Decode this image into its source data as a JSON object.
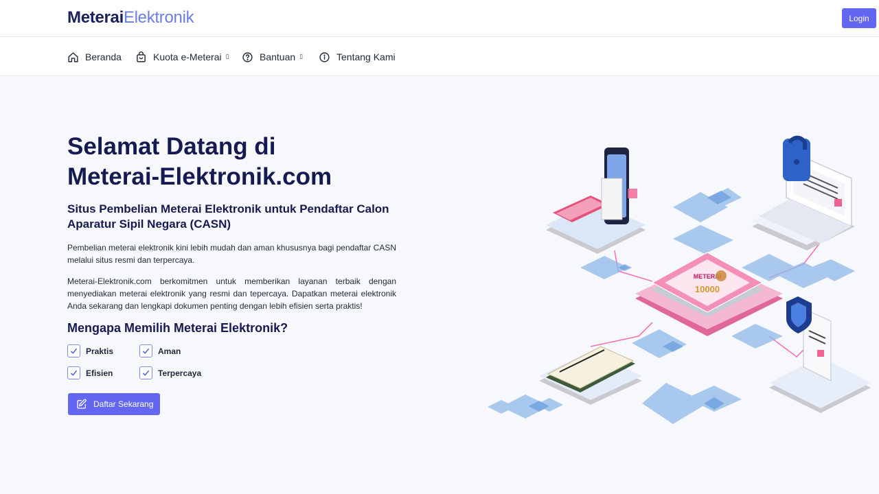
{
  "header": {
    "logo_bold": "Meterai",
    "logo_light": "Elektronik",
    "login_label": "Login"
  },
  "nav": {
    "items": [
      {
        "label": "Beranda",
        "icon": "home-icon",
        "caret": ""
      },
      {
        "label": "Kuota e-Meterai",
        "icon": "bag-icon",
        "caret": "▯"
      },
      {
        "label": "Bantuan",
        "icon": "help-circle-icon",
        "caret": "▯"
      },
      {
        "label": "Tentang Kami",
        "icon": "info-circle-icon",
        "caret": ""
      }
    ]
  },
  "hero": {
    "title_line1": "Selamat Datang di",
    "title_line2": "Meterai-Elektronik.com",
    "subtitle": "Situs Pembelian Meterai Elektronik untuk Pendaftar Calon Aparatur Sipil Negara (CASN)",
    "paragraph1": "Pembelian meterai elektronik kini lebih mudah dan aman khususnya bagi pendaftar CASN melalui situs resmi dan terpercaya.",
    "paragraph2": "Meterai-Elektronik.com berkomitmen untuk memberikan layanan terbaik dengan menyediakan meterai elektronik yang resmi dan tepercaya. Dapatkan meterai elektronik Anda sekarang dan lengkapi dokumen penting dengan lebih efisien serta praktis!",
    "why_title": "Mengapa Memilih Meterai Elektronik?",
    "benefits": [
      "Praktis",
      "Aman",
      "Efisien",
      "Terpercaya"
    ],
    "cta_label": "Daftar Sekarang"
  },
  "illustration": {
    "stamp_label": "METERAI",
    "stamp_value": "10000"
  },
  "colors": {
    "primary": "#6366f1",
    "heading": "#161a52",
    "logo_light": "#6b7ee6",
    "background": "#f7f8fb"
  }
}
